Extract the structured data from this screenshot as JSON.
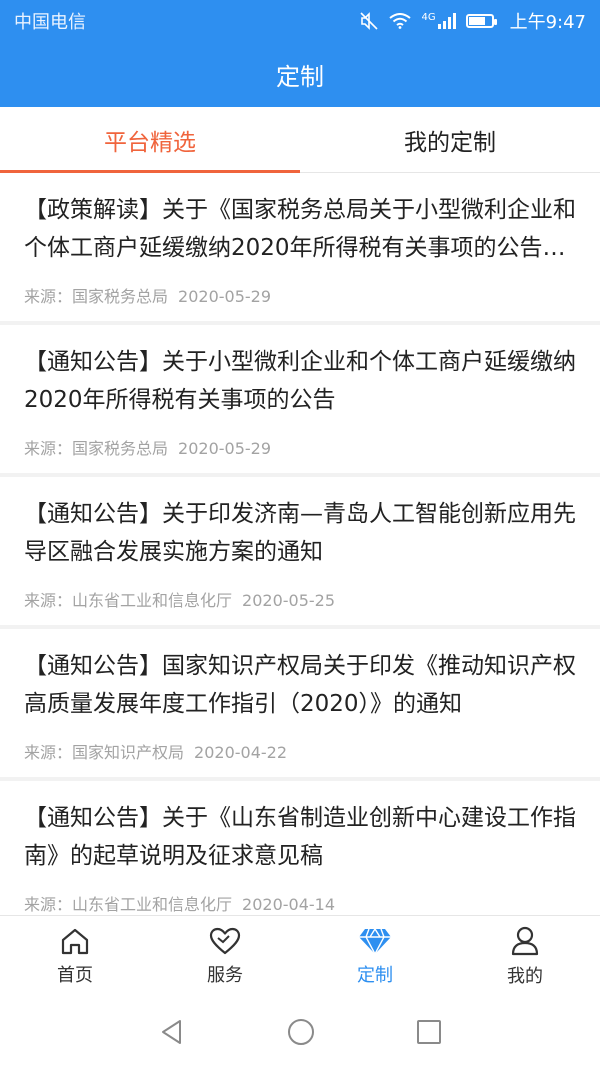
{
  "status_bar": {
    "carrier": "中国电信",
    "network": "4G",
    "time": "上午9:47"
  },
  "header": {
    "title": "定制"
  },
  "tabs": [
    {
      "label": "平台精选",
      "active": true
    },
    {
      "label": "我的定制",
      "active": false
    }
  ],
  "news": [
    {
      "title": "【政策解读】关于《国家税务总局关于小型微利企业和个体工商户延缓缴纳2020年所得税有关事项的公告》的解读",
      "source_label": "来源：",
      "source": "国家税务总局",
      "date": "2020-05-29"
    },
    {
      "title": "【通知公告】关于小型微利企业和个体工商户延缓缴纳2020年所得税有关事项的公告",
      "source_label": "来源：",
      "source": "国家税务总局",
      "date": "2020-05-29"
    },
    {
      "title": "【通知公告】关于印发济南—青岛人工智能创新应用先导区融合发展实施方案的通知",
      "source_label": "来源：",
      "source": "山东省工业和信息化厅",
      "date": "2020-05-25"
    },
    {
      "title": "【通知公告】国家知识产权局关于印发《推动知识产权高质量发展年度工作指引（2020）》的通知",
      "source_label": "来源：",
      "source": "国家知识产权局",
      "date": "2020-04-22"
    },
    {
      "title": "【通知公告】关于《山东省制造业创新中心建设工作指南》的起草说明及征求意见稿",
      "source_label": "来源：",
      "source": "山东省工业和信息化厅",
      "date": "2020-04-14"
    }
  ],
  "bottom_nav": [
    {
      "label": "首页",
      "icon": "home-icon",
      "active": false
    },
    {
      "label": "服务",
      "icon": "heart-icon",
      "active": false
    },
    {
      "label": "定制",
      "icon": "diamond-icon",
      "active": true
    },
    {
      "label": "我的",
      "icon": "user-icon",
      "active": false
    }
  ],
  "colors": {
    "primary": "#2e8ff0",
    "accent": "#f0643c",
    "meta_text": "#a3a3a3"
  }
}
